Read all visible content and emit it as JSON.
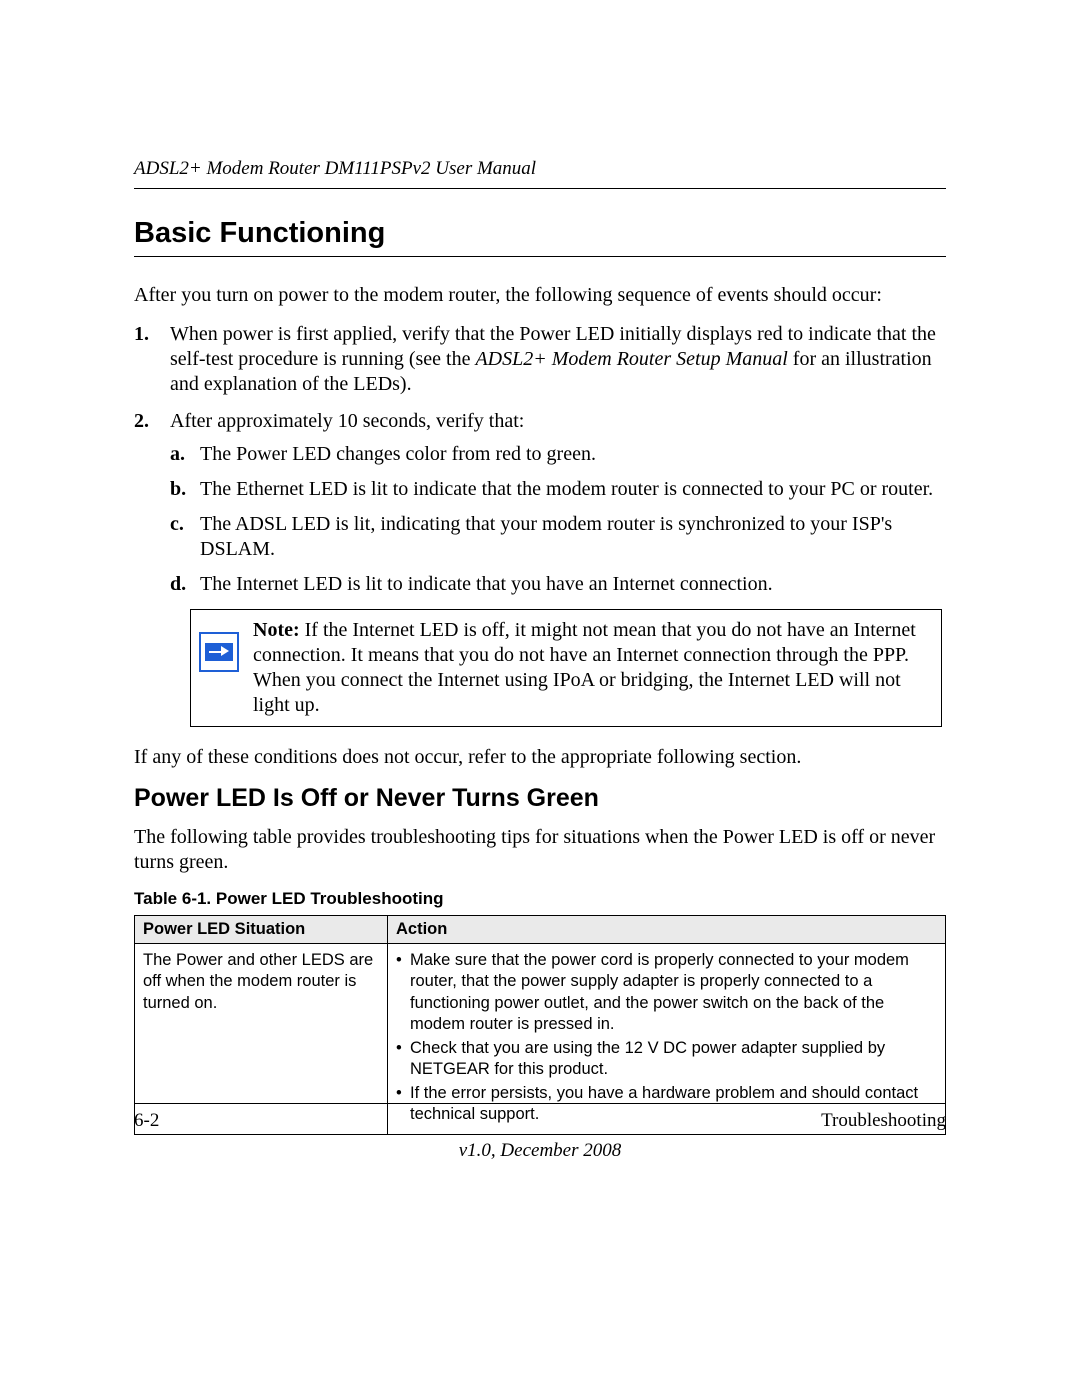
{
  "header": {
    "running_title": "ADSL2+ Modem Router DM111PSPv2 User Manual"
  },
  "section1": {
    "title": "Basic Functioning",
    "intro": "After you turn on power to the modem router, the following sequence of events should occur:",
    "items": [
      {
        "text_a": "When power is first applied, verify that the Power LED initially displays red to indicate that the self-test procedure is running (see the ",
        "text_italic": "ADSL2+ Modem Router Setup Manual",
        "text_b": " for an illustration and explanation of the LEDs)."
      },
      {
        "text_a": "After approximately 10 seconds, verify that:",
        "subitems": [
          "The Power LED changes color from red to green.",
          "The Ethernet LED is lit to indicate that the modem router is connected to your PC or router.",
          "The ADSL LED is lit, indicating that your modem router is synchronized to your ISP's DSLAM.",
          "The Internet LED is lit to indicate that you have an Internet connection."
        ]
      }
    ],
    "note_label": "Note:",
    "note_text": " If the Internet LED is off, it might not mean that you do not have an Internet connection. It means that you do not have an Internet connection through the PPP. When you connect the Internet using IPoA or bridging, the Internet LED will not light up.",
    "closing": "If any of these conditions does not occur, refer to the appropriate following section."
  },
  "section2": {
    "title": "Power LED Is Off or Never Turns Green",
    "intro": "The following table provides troubleshooting tips for situations when the Power LED is off or never turns green.",
    "table_caption": "Table 6-1.   Power LED Troubleshooting",
    "col1": "Power LED Situation",
    "col2": "Action",
    "row1_situation": "The Power and other LEDS are off when the modem router is turned on.",
    "row1_actions": [
      "Make sure that the power cord is properly connected to your modem router, that the power supply adapter is properly connected to a functioning power outlet, and the power switch on the back of the modem router is pressed in.",
      "Check that you are using the 12 V DC power adapter supplied by NETGEAR for this product.",
      "If the error persists, you have a hardware problem and should contact technical support."
    ]
  },
  "footer": {
    "page_num": "6-2",
    "section_name": "Troubleshooting",
    "version": "v1.0, December 2008"
  }
}
